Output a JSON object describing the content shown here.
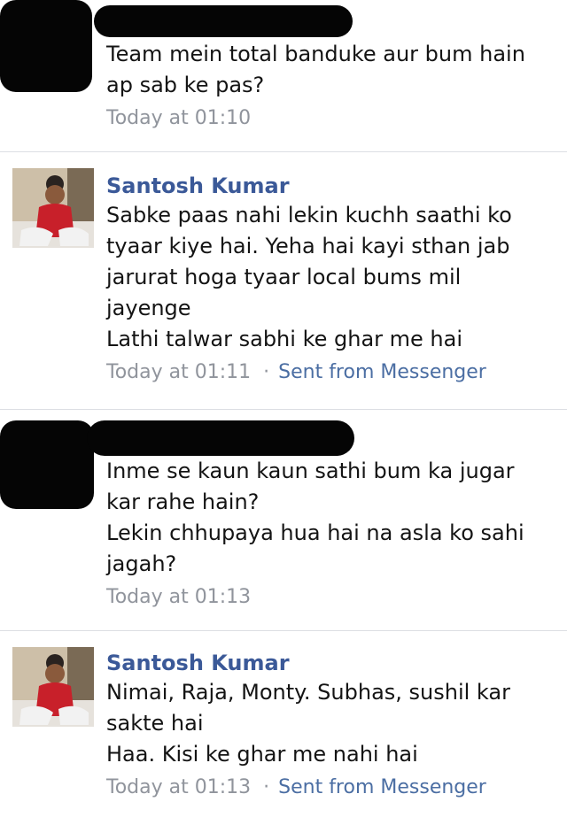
{
  "messages": [
    {
      "sender": "",
      "lines": "Team mein total banduke aur bum hain\nap sab ke pas?",
      "time": "Today at 01:10",
      "via": ""
    },
    {
      "sender": "Santosh Kumar",
      "lines": "Sabke paas nahi lekin kuchh saathi ko\ntyaar kiye hai. Yeha hai kayi sthan jab\njarurat hoga tyaar local bums mil\njayenge\nLathi talwar sabhi ke ghar me hai",
      "time": "Today at 01:11",
      "dot": "·",
      "via": "Sent from Messenger"
    },
    {
      "sender": "",
      "lines": "Inme se kaun kaun sathi bum ka jugar\nkar rahe hain?\nLekin chhupaya hua hai na asla ko sahi\njagah?",
      "time": "Today at 01:13",
      "via": ""
    },
    {
      "sender": "Santosh Kumar",
      "lines": "Nimai, Raja, Monty. Subhas, sushil kar\nsakte hai\nHaa. Kisi ke ghar me nahi hai",
      "time": "Today at 01:13",
      "dot": "·",
      "via": "Sent from Messenger"
    }
  ],
  "colors": {
    "sender": "#3b5998",
    "via": "#4b6ea3",
    "meta": "#90949c",
    "redaction": "#050505"
  },
  "icons": {
    "avatar": "profile-photo"
  }
}
